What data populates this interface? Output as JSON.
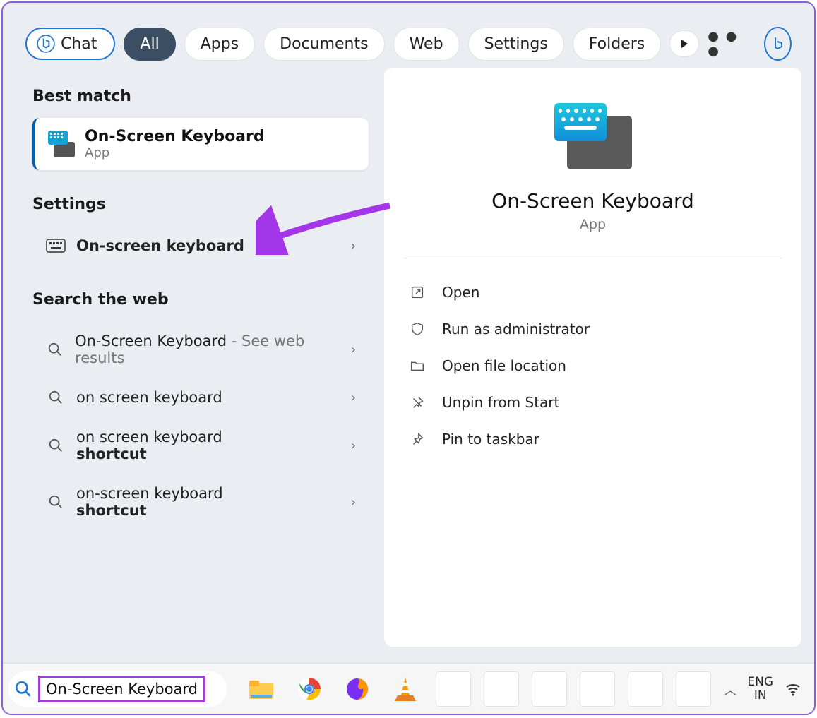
{
  "tabs": {
    "chat": "Chat",
    "all": "All",
    "apps": "Apps",
    "documents": "Documents",
    "web": "Web",
    "settings": "Settings",
    "folders": "Folders"
  },
  "sections": {
    "best_match": "Best match",
    "settings": "Settings",
    "search_web": "Search the web"
  },
  "best_match": {
    "title": "On-Screen Keyboard",
    "subtitle": "App"
  },
  "settings_items": [
    {
      "label": "On-screen keyboard"
    }
  ],
  "web_items": [
    {
      "primary": "On-Screen Keyboard",
      "suffix": " - See web results",
      "secondary": ""
    },
    {
      "primary": "on screen keyboard",
      "suffix": "",
      "secondary": ""
    },
    {
      "primary": "on screen keyboard",
      "suffix": "",
      "secondary": "shortcut"
    },
    {
      "primary": "on-screen keyboard",
      "suffix": "",
      "secondary": "shortcut"
    }
  ],
  "detail": {
    "title": "On-Screen Keyboard",
    "subtitle": "App",
    "actions": {
      "open": "Open",
      "run_admin": "Run as administrator",
      "open_loc": "Open file location",
      "unpin": "Unpin from Start",
      "pin_taskbar": "Pin to taskbar"
    }
  },
  "taskbar": {
    "search_value": "On-Screen Keyboard",
    "lang_top": "ENG",
    "lang_bottom": "IN"
  }
}
